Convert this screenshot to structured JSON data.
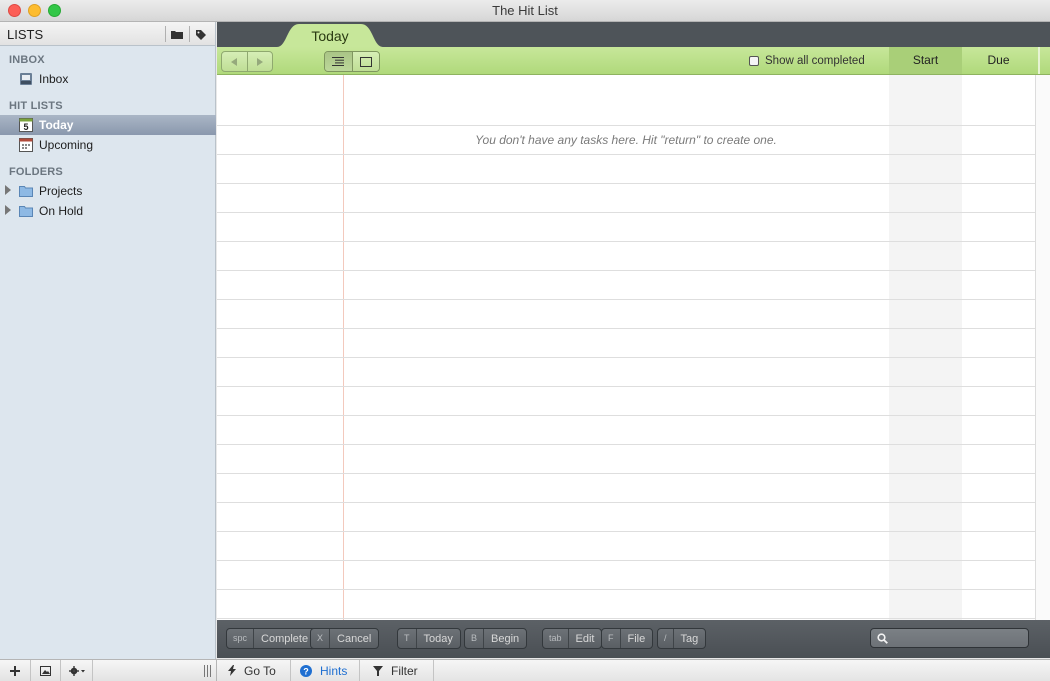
{
  "window": {
    "title": "The Hit List"
  },
  "sidebar": {
    "header_title": "LISTS",
    "sections": {
      "inbox": "INBOX",
      "hit_lists": "HIT LISTS",
      "folders": "FOLDERS"
    },
    "inbox_item": "Inbox",
    "hit_list_items": [
      "Today",
      "Upcoming"
    ],
    "today_date_number": "5",
    "folder_items": [
      "Projects",
      "On Hold"
    ]
  },
  "tabs": {
    "active": "Today"
  },
  "toolbar": {
    "show_all_completed": "Show all completed",
    "col_start": "Start",
    "col_due": "Due"
  },
  "content": {
    "empty_message": "You don't have any tasks here. Hit \"return\" to create one."
  },
  "hints": [
    {
      "key": "spc",
      "label": "Complete"
    },
    {
      "key": "X",
      "label": "Cancel"
    },
    {
      "key": "T",
      "label": "Today"
    },
    {
      "key": "B",
      "label": "Begin"
    },
    {
      "key": "tab",
      "label": "Edit"
    },
    {
      "key": "F",
      "label": "File"
    },
    {
      "key": "/",
      "label": "Tag"
    }
  ],
  "bottom_bar": {
    "goto": "Go To",
    "hints": "Hints",
    "filter": "Filter"
  },
  "colors": {
    "accent_green": "#b8de86",
    "selection": "#8a98ad",
    "hints_blue": "#1f6fd1"
  }
}
